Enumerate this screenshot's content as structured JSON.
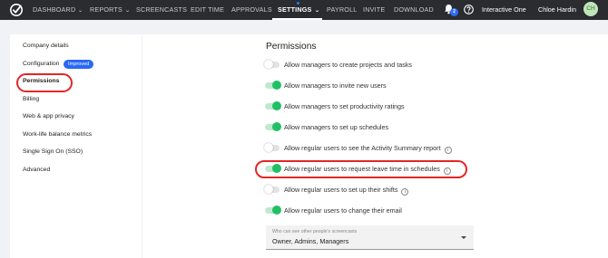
{
  "nav": {
    "items": [
      {
        "label": "DASHBOARD",
        "chevron": true
      },
      {
        "label": "REPORTS",
        "chevron": true
      },
      {
        "label": "SCREENCASTS",
        "chevron": false
      },
      {
        "label": "EDIT TIME",
        "chevron": false
      },
      {
        "label": "APPROVALS",
        "chevron": false
      },
      {
        "label": "SETTINGS",
        "chevron": true,
        "active": true
      },
      {
        "label": "PAYROLL",
        "chevron": false
      },
      {
        "label": "INVITE",
        "chevron": false
      },
      {
        "label": "DOWNLOAD",
        "chevron": false
      }
    ],
    "notification_count": "2",
    "org_name": "Interactive One",
    "user_name": "Chloe Hardin",
    "avatar_initials": "CH"
  },
  "sidebar": {
    "items": [
      {
        "label": "Company details"
      },
      {
        "label": "Configuration",
        "badge": "Improved"
      },
      {
        "label": "Permissions",
        "active": true
      },
      {
        "label": "Billing"
      },
      {
        "label": "Web & app privacy"
      },
      {
        "label": "Work-life balance metrics"
      },
      {
        "label": "Single Sign On (SSO)"
      },
      {
        "label": "Advanced"
      }
    ]
  },
  "main": {
    "title": "Permissions",
    "permissions": [
      {
        "label": "Allow managers to create projects and tasks",
        "enabled": false,
        "info": false
      },
      {
        "label": "Allow managers to invite new users",
        "enabled": true,
        "info": false
      },
      {
        "label": "Allow managers to set productivity ratings",
        "enabled": true,
        "info": false
      },
      {
        "label": "Allow managers to set up schedules",
        "enabled": true,
        "info": false
      },
      {
        "label": "Allow regular users to see the Activity Summary report",
        "enabled": false,
        "info": true
      },
      {
        "label": "Allow regular users to request leave time in schedules",
        "enabled": true,
        "info": true
      },
      {
        "label": "Allow regular users to set up their shifts",
        "enabled": false,
        "info": true
      },
      {
        "label": "Allow regular users to change their email",
        "enabled": true,
        "info": false
      }
    ],
    "screencast_select": {
      "label": "Who can see other people's screencasts",
      "value": "Owner, Admins, Managers"
    }
  },
  "colors": {
    "topbar": "#2b2c30",
    "toggle_on": "#21c064",
    "badge_blue": "#2868f6",
    "highlight_red": "#e32626"
  }
}
